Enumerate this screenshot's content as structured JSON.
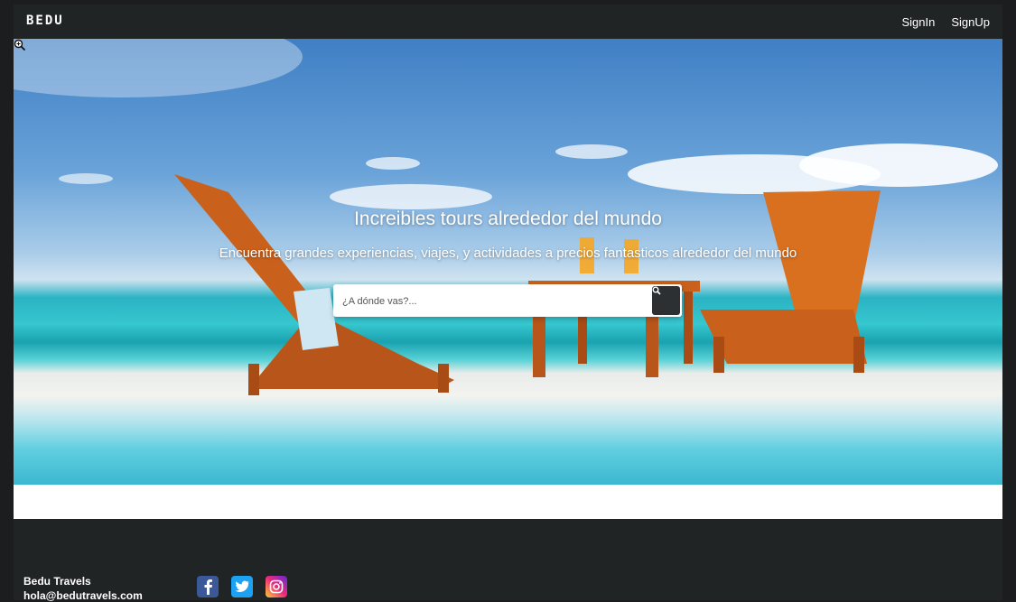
{
  "brand": {
    "logo_text": "BEDU",
    "name": "Bedu Travels",
    "email": "hola@bedutravels.com"
  },
  "nav": {
    "signin_label": "SignIn",
    "signup_label": "SignUp"
  },
  "hero": {
    "title": "Increibles tours alrededor del mundo",
    "subtitle": "Encuentra grandes experiencias, viajes, y actividades a precios fantasticos alrededor del mundo"
  },
  "search": {
    "placeholder": "¿A dónde vas?...",
    "value": "",
    "button_icon": "search-icon"
  },
  "social": [
    {
      "name": "facebook-icon",
      "color": "#3b5998"
    },
    {
      "name": "twitter-icon",
      "color": "#1da1f2"
    },
    {
      "name": "instagram-icon",
      "color": "#e1306c"
    }
  ]
}
